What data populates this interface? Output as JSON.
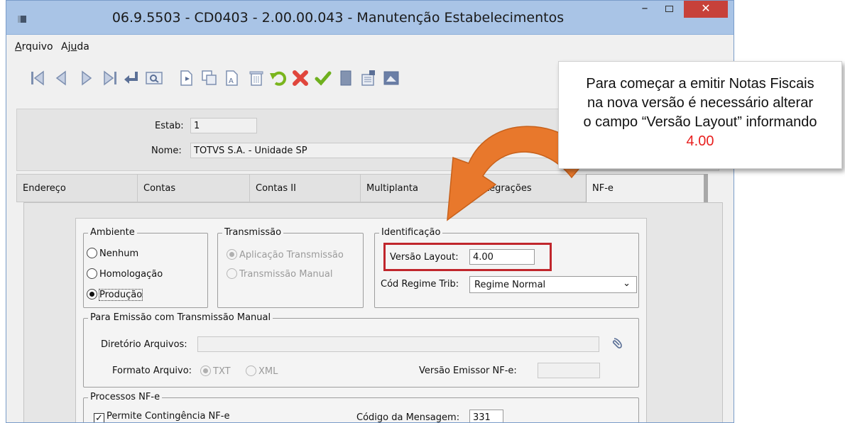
{
  "window": {
    "title": "06.9.5503 - CD0403 - 2.00.00.043 - Manutenção Estabelecimentos",
    "min": "–",
    "close": "✕"
  },
  "menu": {
    "arquivo_u": "A",
    "arquivo_rest": "rquivo",
    "ajuda_a": "Aj",
    "ajuda_u": "u",
    "ajuda_rest": "da"
  },
  "toolbar_icons": [
    "first-icon",
    "prev-icon",
    "next-icon",
    "last-icon",
    "go-to-icon",
    "search-icon",
    "copy-icon",
    "new-icon",
    "edit-icon",
    "delete-icon",
    "undo-icon",
    "cancel-icon",
    "confirm-icon",
    "list-icon",
    "query-icon",
    "report-icon"
  ],
  "header": {
    "estab_label": "Estab:",
    "estab_value": "1",
    "nome_label": "Nome:",
    "nome_value": "TOTVS S.A. - Unidade SP"
  },
  "tabs": [
    "Endereço",
    "Contas",
    "Contas II",
    "Multiplanta",
    "Integrações",
    "NF-e"
  ],
  "active_tab": "NF-e",
  "ambiente": {
    "title": "Ambiente",
    "options": [
      "Nenhum",
      "Homologação",
      "Produção"
    ],
    "selected": "Produção"
  },
  "transmissao": {
    "title": "Transmissão",
    "options": [
      "Aplicação Transmissão",
      "Transmissão Manual"
    ],
    "selected": "Aplicação Transmissão"
  },
  "identificacao": {
    "title": "Identificação",
    "versao_label": "Versão Layout:",
    "versao_value": "4.00",
    "regime_label": "Cód Regime Trib:",
    "regime_value": "Regime Normal"
  },
  "manual": {
    "title": "Para Emissão com Transmissão Manual",
    "diretorio_label": "Diretório Arquivos:",
    "formato_label": "Formato Arquivo:",
    "formato_options": [
      "TXT",
      "XML"
    ],
    "formato_selected": "TXT",
    "emissor_label": "Versão Emissor NF-e:"
  },
  "processos": {
    "title": "Processos NF-e",
    "contingencia_label": "Permite Contingência NF-e",
    "contingencia_checked": true,
    "mensagem_label": "Código da Mensagem:",
    "mensagem_value": "331"
  },
  "callout": {
    "line1": "Para começar a emitir Notas Fiscais",
    "line2": "na nova versão é necessário alterar",
    "line3": "o campo “Versão Layout” informando",
    "line4": "4.00"
  },
  "colors": {
    "title_bar": "#a9c4e6",
    "close_button": "#c7413a",
    "highlight_box": "#c0262c",
    "arrow": "#e8782c",
    "callout_value": "#e8201f"
  }
}
